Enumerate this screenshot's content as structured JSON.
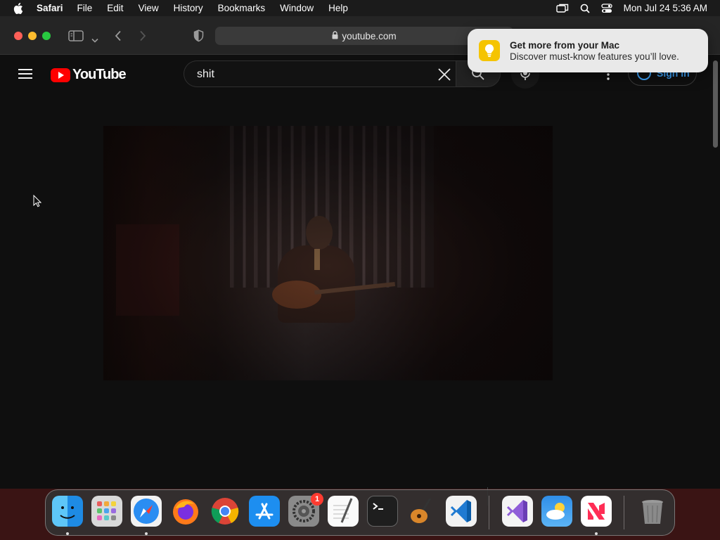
{
  "menubar": {
    "app_name": "Safari",
    "items": [
      "File",
      "Edit",
      "View",
      "History",
      "Bookmarks",
      "Window",
      "Help"
    ],
    "clock": "Mon Jul 24  5:36 AM"
  },
  "browser": {
    "url": "youtube.com"
  },
  "youtube": {
    "logo_text": "YouTube",
    "search_value": "shit",
    "sign_in_label": "Sign in"
  },
  "notification": {
    "title": "Get more from your Mac",
    "body": "Discover must-know features you’ll love."
  },
  "dock": {
    "apps": [
      "Finder",
      "Launchpad",
      "Safari",
      "Firefox",
      "Chrome",
      "App Store",
      "System Settings",
      "TextEdit",
      "Terminal",
      "GarageBand",
      "Visual Studio Code",
      "Visual Studio",
      "Weather",
      "News",
      "Trash"
    ],
    "settings_badge": "1"
  },
  "colors": {
    "youtube_red": "#ff0000",
    "link_blue": "#3ea6ff",
    "page_bg": "#0f0f0f"
  }
}
